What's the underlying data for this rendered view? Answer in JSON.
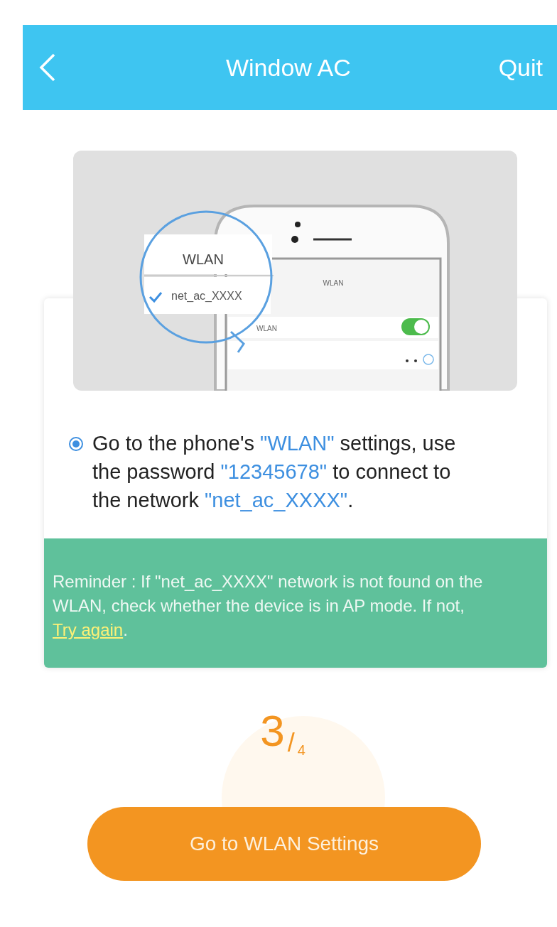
{
  "header": {
    "title": "Window AC",
    "action": "Quit"
  },
  "illustration": {
    "magnifier_title": "WLAN",
    "network": "net_ac_XXXX",
    "connected": true,
    "screen_title": "WLAN",
    "screen_row": "WLAN",
    "wlan_on": true
  },
  "instruction": {
    "selected": true,
    "segments": [
      {
        "kind": "text",
        "text": "Go to the phone's "
      },
      {
        "kind": "highlight",
        "text": "\"WLAN\""
      },
      {
        "kind": "text",
        "text": " settings, use the password "
      },
      {
        "kind": "highlight",
        "text": "\"12345678\""
      },
      {
        "kind": "text",
        "text": " to connect to the network "
      },
      {
        "kind": "highlight",
        "text": "\"net_ac_XXXX\""
      },
      {
        "kind": "text",
        "text": "."
      }
    ]
  },
  "reminder": {
    "segments": [
      {
        "kind": "text",
        "text": "Reminder :  If \"net_ac_XXXX\" network is not found on the WLAN, check whether the device is in AP mode. If not, "
      },
      {
        "kind": "link",
        "text": "Try again"
      },
      {
        "kind": "text",
        "text": "."
      }
    ]
  },
  "progress": {
    "current": "3",
    "separator": "/",
    "total": "4"
  },
  "button": "Go to WLAN Settings"
}
